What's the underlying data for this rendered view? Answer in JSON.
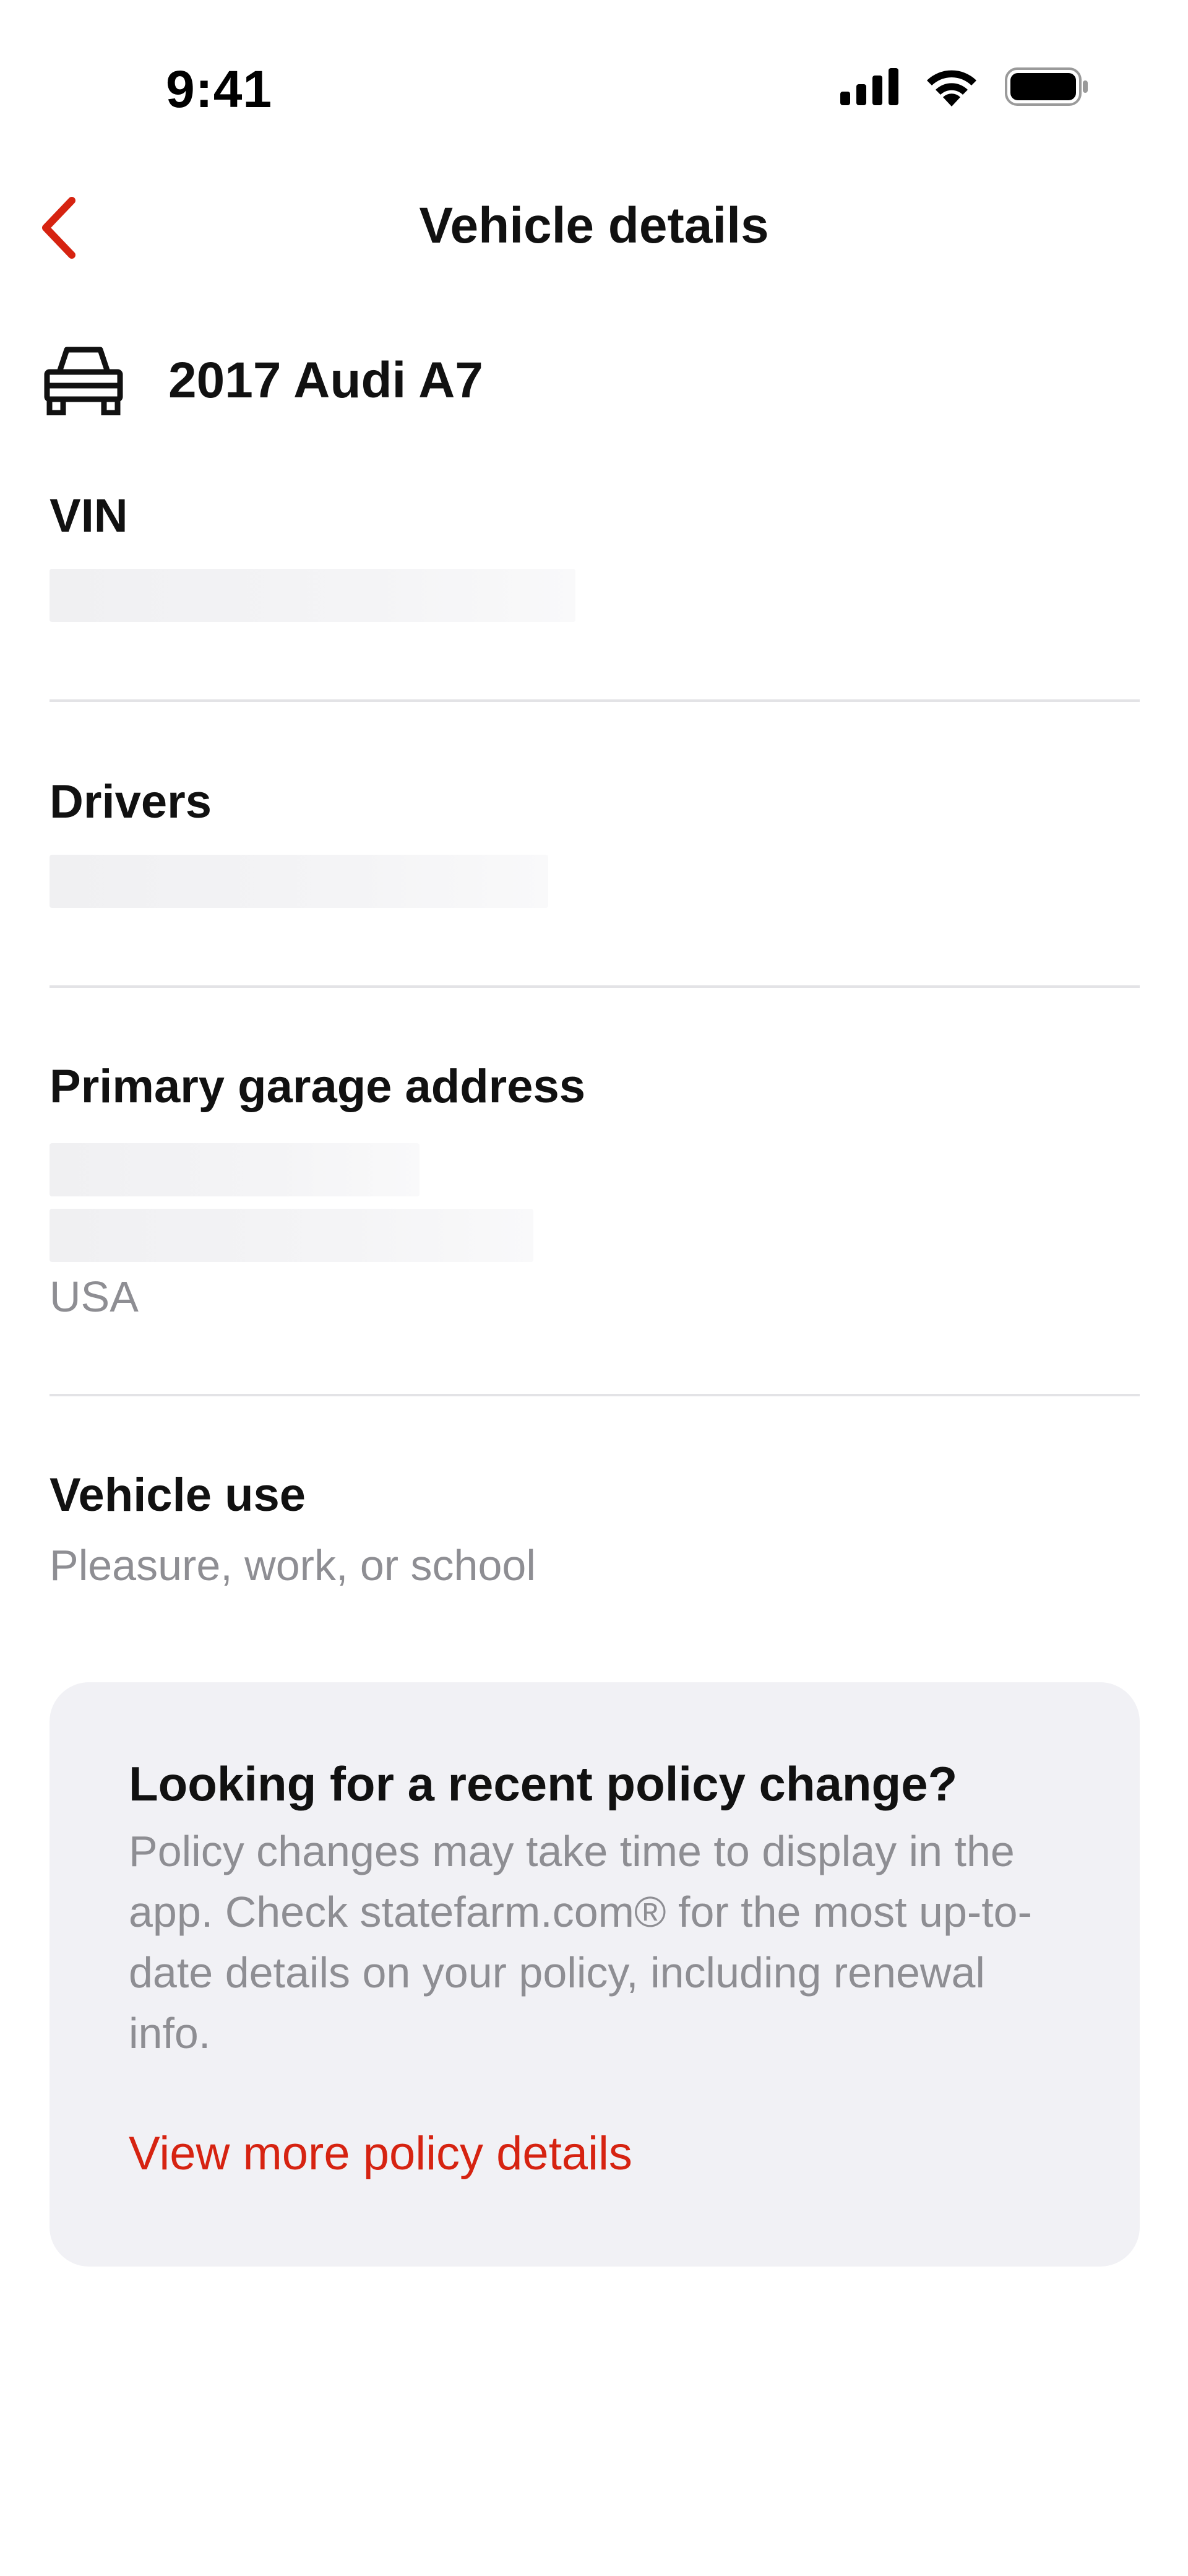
{
  "status_bar": {
    "time": "9:41",
    "icons": [
      "cellular-signal-icon",
      "wifi-icon",
      "battery-icon"
    ]
  },
  "nav": {
    "title": "Vehicle details",
    "back_icon": "chevron-left-icon"
  },
  "vehicle": {
    "icon": "car-icon",
    "name": "2017 Audi A7"
  },
  "sections": {
    "vin": {
      "label": "VIN"
    },
    "drivers": {
      "label": "Drivers"
    },
    "garage": {
      "label": "Primary garage address",
      "country": "USA"
    },
    "use": {
      "label": "Vehicle use",
      "value": "Pleasure, work, or school"
    }
  },
  "info_card": {
    "title": "Looking for a recent policy change?",
    "body": "Policy changes may take time to display in the app. Check statefarm.com® for the most up-to-date details on your policy, including renewal info.",
    "link": "View more policy details"
  },
  "colors": {
    "accent": "#d62311",
    "text_primary": "#111111",
    "text_secondary": "#8e8e93",
    "card_background": "#f1f1f5",
    "divider": "#e3e3e6"
  }
}
